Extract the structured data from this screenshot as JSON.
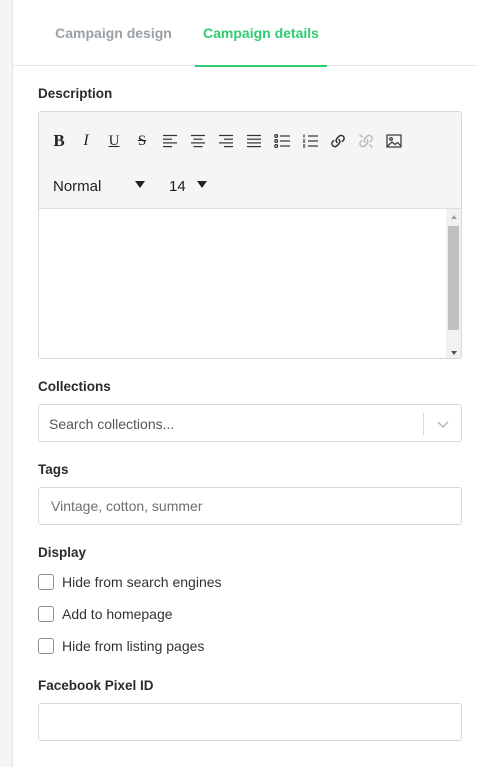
{
  "tabs": [
    {
      "label": "Campaign design",
      "active": false
    },
    {
      "label": "Campaign details",
      "active": true
    }
  ],
  "accent_color": "#2ecc71",
  "description": {
    "label": "Description",
    "toolbar": {
      "buttons": [
        "bold-icon",
        "italic-icon",
        "underline-icon",
        "strikethrough-icon",
        "align-left-icon",
        "align-center-icon",
        "align-right-icon",
        "align-justify-icon",
        "bullet-list-icon",
        "numbered-list-icon",
        "link-icon",
        "unlink-icon",
        "image-icon"
      ],
      "format_value": "Normal",
      "size_value": "14"
    },
    "value": ""
  },
  "collections": {
    "label": "Collections",
    "placeholder": "Search collections..."
  },
  "tags": {
    "label": "Tags",
    "placeholder": "Vintage, cotton, summer"
  },
  "display": {
    "label": "Display",
    "options": [
      {
        "label": "Hide from search engines",
        "checked": false
      },
      {
        "label": "Add to homepage",
        "checked": false
      },
      {
        "label": "Hide from listing pages",
        "checked": false
      }
    ]
  },
  "pixel": {
    "label": "Facebook Pixel ID",
    "value": ""
  }
}
